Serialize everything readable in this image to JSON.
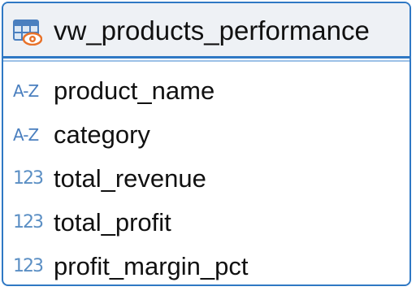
{
  "view": {
    "name": "vw_products_performance",
    "icon": "view-table-eye-icon"
  },
  "columns": [
    {
      "name": "product_name",
      "type_icon": "string-type-icon",
      "type_label": "A-Z"
    },
    {
      "name": "category",
      "type_icon": "string-type-icon",
      "type_label": "A-Z"
    },
    {
      "name": "total_revenue",
      "type_icon": "numeric-type-icon",
      "type_label": "123"
    },
    {
      "name": "total_profit",
      "type_icon": "numeric-type-icon",
      "type_label": "123"
    },
    {
      "name": "profit_margin_pct",
      "type_icon": "numeric-type-icon",
      "type_label": "123"
    }
  ],
  "colors": {
    "border": "#2f78c4",
    "header_bg": "#eef1f5",
    "icon_blue": "#5b8fc4",
    "icon_orange": "#e8722a"
  }
}
